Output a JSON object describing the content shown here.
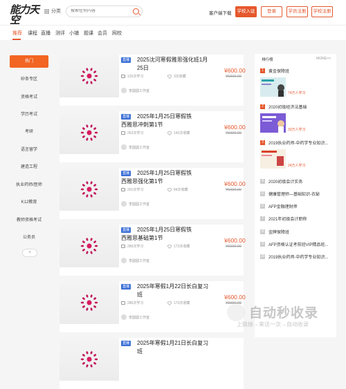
{
  "header": {
    "logo_main": "能力天空",
    "logo_sub": "nengliSky.com",
    "category_label": "分类",
    "search_placeholder": "搜索任何内容",
    "download_label": "客户端下载",
    "join_label": "学校入驻",
    "login_label": "登录",
    "student_register_label": "学员注册",
    "school_register_label": "学校注册"
  },
  "nav": {
    "tabs": [
      "推荐",
      "课程",
      "直播",
      "测评",
      "小铺",
      "题课",
      "会员",
      "网校"
    ],
    "active": "推荐"
  },
  "sidebar": {
    "items": [
      "热门",
      "砂条专区",
      "资格考试",
      "学历考试",
      "考研",
      "语言留学",
      "建造工程",
      "执业药师/医师",
      "K12教育",
      "教师资格考试",
      "公务员"
    ],
    "active": "热门",
    "more": "+"
  },
  "courses": [
    {
      "badge": "直播",
      "title": "2025沈河寒假雅思强化班1月25日",
      "learners": "125次学习",
      "favs": "3次收藏",
      "studio": "李圆圆工作室",
      "price": "¥600.00",
      "old_price": "¥6000.00"
    },
    {
      "badge": "直播",
      "title": "2025年1月25日寒假铁西雅思冲刺第1节",
      "learners": "263次学习",
      "favs": "143次收藏",
      "studio": "李圆圆工作室",
      "price": "¥600.00",
      "old_price": "¥6000.00"
    },
    {
      "badge": "直播",
      "title": "2025年1月25日寒假铁西雅思强化第1节",
      "learners": "201次学习",
      "favs": "84次收藏",
      "studio": "李圆圆工作室",
      "price": "¥600.00",
      "old_price": "¥6000.00"
    },
    {
      "badge": "直播",
      "title": "2025年1月25日寒假铁西雅思基础第1节",
      "learners": "289次学习",
      "favs": "173次收藏",
      "studio": "李圆圆工作室",
      "price": "¥600.00",
      "old_price": "¥6000.00"
    },
    {
      "badge": "直播",
      "title": "2025年寒假1月22日长白复习班",
      "learners": "286次学习",
      "favs": "173次收藏",
      "studio": "李圆圆工作室",
      "price": "¥600.00",
      "old_price": "¥6000.00"
    },
    {
      "badge": "直播",
      "title": "2025年寒假1月21日长白复习班",
      "learners": "",
      "favs": "",
      "studio": "",
      "price": "",
      "old_price": ""
    }
  ],
  "ranking": {
    "title": "排行榜",
    "more": "MORE>>",
    "items": [
      {
        "num": "1",
        "title": "黄金保障班",
        "info": "74万人学习"
      },
      {
        "num": "2",
        "title": "2020初级经济法基础",
        "info": "33万人学习"
      },
      {
        "num": "3",
        "title": "2019执业药师-中药学专业知识...",
        "info": "24万人学习"
      },
      {
        "num": "4",
        "title": "2020初级会计实务",
        "info": ""
      },
      {
        "num": "5",
        "title": "健康管理师—基础知识-衣鉍",
        "info": ""
      },
      {
        "num": "6",
        "title": "AFP金融理财师",
        "info": ""
      },
      {
        "num": "7",
        "title": "2021年初级会计职称",
        "info": ""
      },
      {
        "num": "8",
        "title": "金牌保障班",
        "info": ""
      },
      {
        "num": "9",
        "title": "AFP资格认证考前班VIP精品班...",
        "info": ""
      },
      {
        "num": "10",
        "title": "2019执业药师-中药学专业知识...",
        "info": ""
      }
    ]
  },
  "watermark": {
    "main": "自动秒收录",
    "sub": "上链接→来访一次→自动收录"
  },
  "colors": {
    "accent": "#e5572c",
    "badge": "#3b6fd6"
  }
}
